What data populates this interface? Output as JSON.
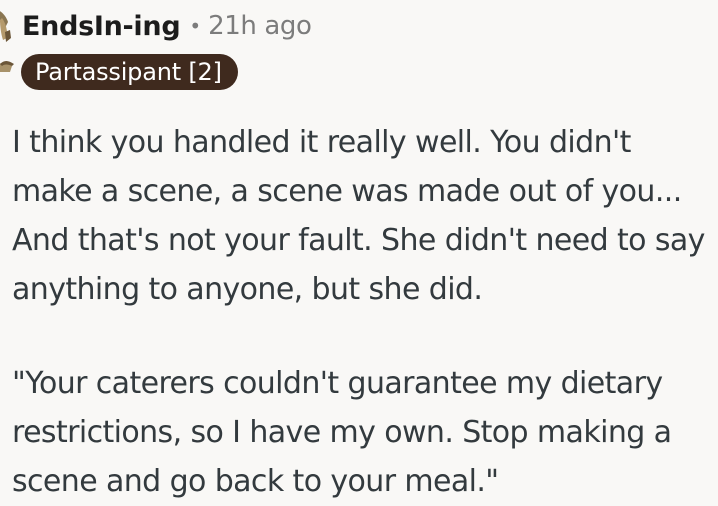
{
  "comment": {
    "username": "EndsIn-ing",
    "separator": "•",
    "timestamp": "21h ago",
    "flair": "Partassipant [2]",
    "paragraphs": [
      "I think you handled it really well. You didn't make a scene, a scene was made out of you... And that's not your fault. She didn't need to say anything to anyone, but she did.",
      "\"Your caterers couldn't guarantee my dietary restrictions, so I have my own. Stop making a scene and go back to your meal.\""
    ]
  },
  "colors": {
    "background": "#f9f8f6",
    "username": "#1c1c1c",
    "meta": "#7c7c7c",
    "flair_bg": "#3f2a1e",
    "flair_text": "#ffffff",
    "body_text": "#333a3e"
  },
  "icons": {
    "avatar": "user-avatar-icon"
  }
}
